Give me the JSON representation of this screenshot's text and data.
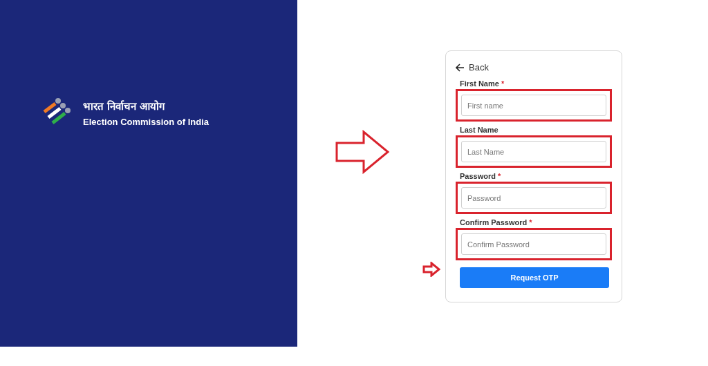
{
  "brand": {
    "title_hindi": "भारत निर्वाचन आयोग",
    "title_english": "Election Commission of India"
  },
  "form": {
    "back": "Back",
    "fields": [
      {
        "label": "First Name",
        "required_mark": "*",
        "placeholder": "First name",
        "highlighted": true
      },
      {
        "label": "Last Name",
        "placeholder": "Last Name",
        "highlighted": true
      },
      {
        "label": "Password",
        "required_mark": "*",
        "placeholder": "Password",
        "highlighted": true
      },
      {
        "label": "Confirm Password",
        "required_mark": "*",
        "placeholder": "Confirm Password",
        "highlighted": true
      }
    ],
    "submit": "Request OTP"
  }
}
